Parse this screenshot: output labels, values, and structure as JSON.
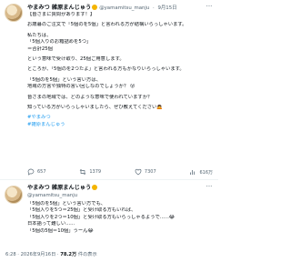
{
  "tweet1": {
    "name": "やまみつ 雑原まんじゅう",
    "handle": "@yamamitsu_manju",
    "date": "9月15日",
    "more": "···",
    "lines": [
      "【皆さまに質問があります！】",
      "",
      "お歳暮のご注文で「5個のを5個」と言われる方が結構いらっしゃいます。",
      "",
      "私たちは、",
      "「5個入りのお箱詰めを5つ」",
      "＝合計25個",
      "",
      "という意味で受け取り、25個ご用意します。",
      "",
      "ところが、「5個のを2つたよ」と言われる方もかなりいらっしゃいます。",
      "",
      "「5個のを5個」という言い方は、",
      "地域の方言や独特の言い回しなのでしょうか？ 😮",
      "",
      "皆さまの地域では、どのような意味で使われていますか？",
      "",
      "知っている方がいらっしゃいましたら、ぜひ教えてください🙇"
    ],
    "hashtags": [
      "#やまみつ",
      "#雑原まんじゅう"
    ],
    "actions": {
      "replies": "657",
      "retweets": "1379",
      "likes": "7307",
      "views": "616万"
    }
  },
  "tweet2": {
    "name": "やまみつ 雑原まんじゅう",
    "handle": "@yamamitsu_manju",
    "more": "···",
    "lines": [
      "「5個のを5個」という言い方でも、",
      "「5個入りを5つ＝25個」と受け取る方もいれば、",
      "「5個入りを2つ＝10個」と受け取る方もいらっしゃるようで......😂",
      "日本語って難しい......",
      "「5個の5個＝10個」うーん😂"
    ],
    "meta_time": "6:28 · 2026年9月16日",
    "meta_views": "78.2万",
    "meta_views_label": "件の表示"
  },
  "colors": {
    "text": "#0f1419",
    "secondary": "#536471",
    "link": "#1d9bf0",
    "verified": "#f4b400"
  },
  "icons": [
    "more-icon",
    "reply-icon",
    "retweet-icon",
    "like-icon",
    "views-icon",
    "verified-icon"
  ]
}
